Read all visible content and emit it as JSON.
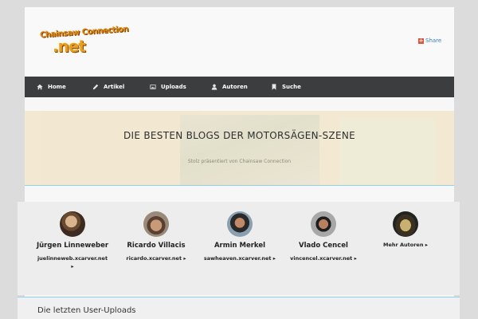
{
  "header": {
    "logo_line1": "Chainsaw Connection",
    "logo_line2": ".net",
    "share_label": "Share"
  },
  "nav": {
    "items": [
      {
        "label": "Home",
        "icon": "home-icon"
      },
      {
        "label": "Artikel",
        "icon": "pencil-icon"
      },
      {
        "label": "Uploads",
        "icon": "image-icon"
      },
      {
        "label": "Autoren",
        "icon": "user-icon"
      },
      {
        "label": "Suche",
        "icon": "bookmark-icon"
      }
    ]
  },
  "banner": {
    "title": "DIE BESTEN BLOGS DER MOTORSÄGEN-SZENE",
    "subtitle": "Stolz präsentiert von Chainsaw Connection"
  },
  "authors": {
    "items": [
      {
        "name": "Jürgen Linneweber",
        "link": "juelinneweb.xcarver.net",
        "arrow": "▸"
      },
      {
        "name": "Ricardo Villacis",
        "link": "ricardo.xcarver.net",
        "arrow": "▸"
      },
      {
        "name": "Armin Merkel",
        "link": "sawheaven.xcarver.net",
        "arrow": "▸"
      },
      {
        "name": "Vlado Cencel",
        "link": "vincencel.xcarver.net",
        "arrow": "▸"
      }
    ],
    "more_label": "Mehr Autoren",
    "more_arrow": "▸"
  },
  "uploads": {
    "title": "Die letzten User-Uploads"
  },
  "colors": {
    "nav_bg": "#3c3d3f",
    "accent_line": "#8fd0ee",
    "share_link": "#3a7fc4"
  }
}
